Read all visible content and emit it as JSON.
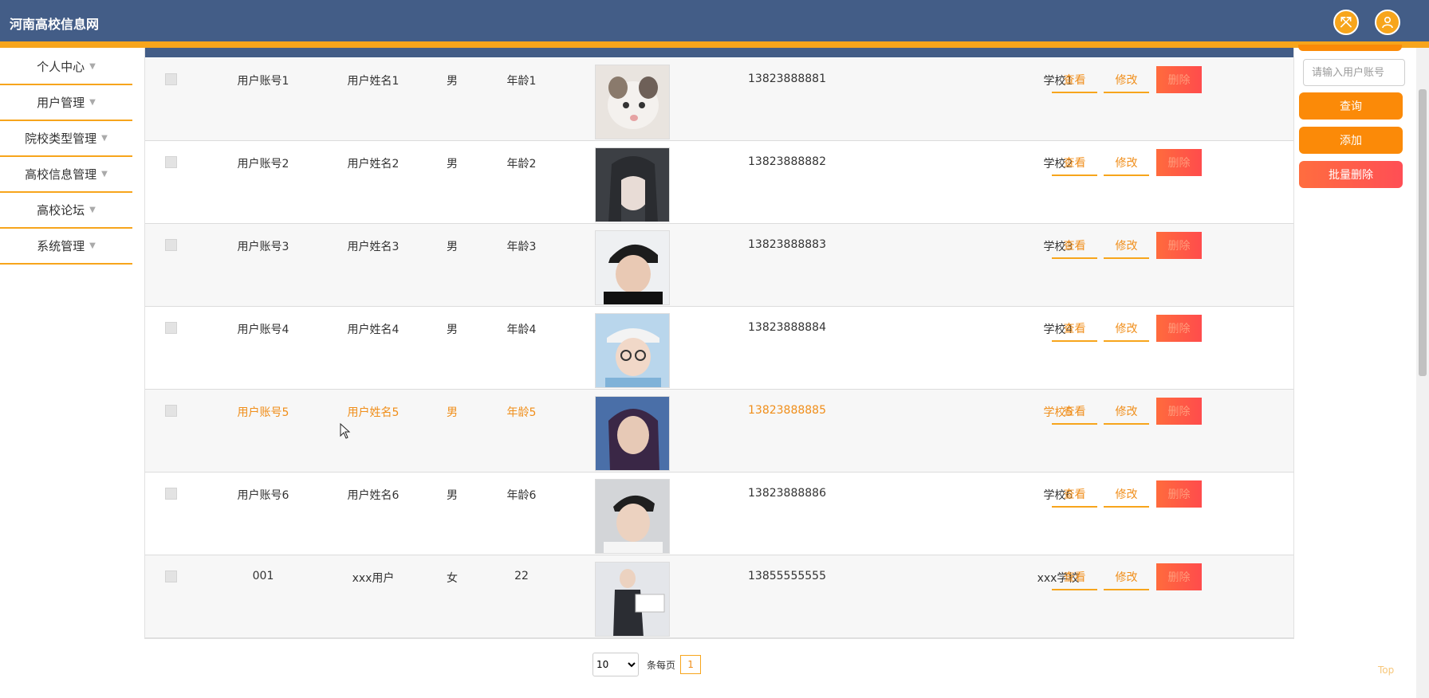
{
  "header": {
    "title": "河南高校信息网"
  },
  "sidebar": {
    "items": [
      {
        "label": "个人中心"
      },
      {
        "label": "用户管理"
      },
      {
        "label": "院校类型管理"
      },
      {
        "label": "高校信息管理"
      },
      {
        "label": "高校论坛"
      },
      {
        "label": "系统管理"
      }
    ]
  },
  "table": {
    "rows": [
      {
        "account": "用户账号1",
        "name": "用户姓名1",
        "sex": "男",
        "age": "年龄1",
        "phone": "13823888881",
        "school": "学校1"
      },
      {
        "account": "用户账号2",
        "name": "用户姓名2",
        "sex": "男",
        "age": "年龄2",
        "phone": "13823888882",
        "school": "学校2"
      },
      {
        "account": "用户账号3",
        "name": "用户姓名3",
        "sex": "男",
        "age": "年龄3",
        "phone": "13823888883",
        "school": "学校3"
      },
      {
        "account": "用户账号4",
        "name": "用户姓名4",
        "sex": "男",
        "age": "年龄4",
        "phone": "13823888884",
        "school": "学校4"
      },
      {
        "account": "用户账号5",
        "name": "用户姓名5",
        "sex": "男",
        "age": "年龄5",
        "phone": "13823888885",
        "school": "学校5"
      },
      {
        "account": "用户账号6",
        "name": "用户姓名6",
        "sex": "男",
        "age": "年龄6",
        "phone": "13823888886",
        "school": "学校6"
      },
      {
        "account": "001",
        "name": "xxx用户",
        "sex": "女",
        "age": "22",
        "phone": "13855555555",
        "school": "xxx学校"
      }
    ],
    "actions": {
      "view": "查看",
      "edit": "修改",
      "delete": "删除"
    }
  },
  "search": {
    "placeholder": "请输入用户账号",
    "query_label": "查询",
    "add_label": "添加",
    "batch_delete_label": "批量删除"
  },
  "pagination": {
    "page_size": "10",
    "per_page_label": "条每页",
    "current_page": "1"
  },
  "back_top": "Top",
  "colors": {
    "header": "#435d87",
    "accent": "#f7a51c",
    "button": "#fb8a08",
    "danger": "#ff4e55"
  }
}
